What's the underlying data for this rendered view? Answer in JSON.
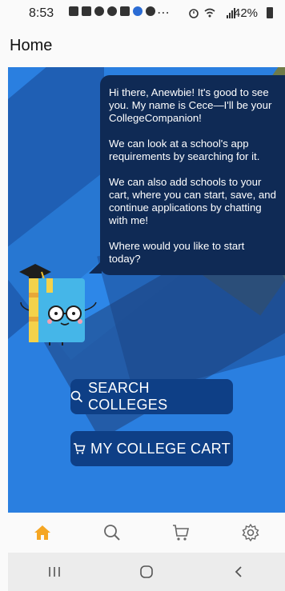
{
  "status_bar": {
    "time": "8:53",
    "overflow": "⋯",
    "battery": "42%"
  },
  "header": {
    "title": "Home"
  },
  "chat": {
    "paragraphs": [
      "Hi there, Anewbie! It's good to see you. My name is Cece—I'll be your CollegeCompanion!",
      "We can look at a school's app requirements by searching for it.",
      "We can also add schools to your cart, where you can start, save, and continue applications by chatting with me!",
      "Where would you like to start today?"
    ]
  },
  "actions": {
    "search_label": "SEARCH COLLEGES",
    "cart_label": "MY COLLEGE CART"
  },
  "bottom_nav": {
    "items": [
      "home-icon",
      "search-icon",
      "cart-icon",
      "settings-icon"
    ],
    "active": "home",
    "active_color": "#f5a623",
    "inactive_color": "#666666"
  },
  "system_nav": {
    "items": [
      "recents-icon",
      "home-circle-icon",
      "back-icon"
    ]
  },
  "colors": {
    "hero_blue": "#2a7fe0",
    "button_navy": "#0e3f86",
    "bubble_navy": "#0f2a55"
  }
}
